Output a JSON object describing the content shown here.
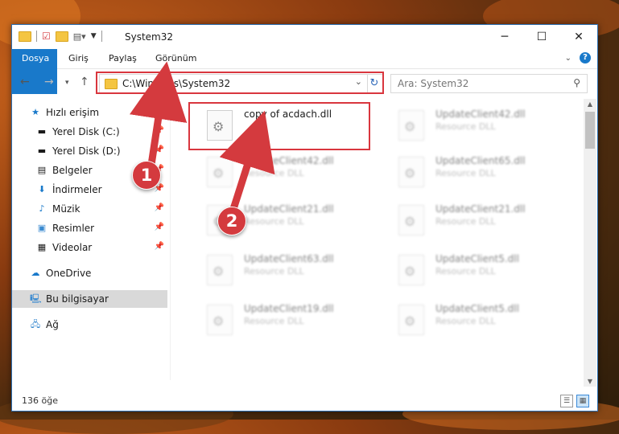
{
  "window": {
    "title": "System32"
  },
  "ribbon": {
    "tabs": [
      {
        "label": "Dosya"
      },
      {
        "label": "Giriş"
      },
      {
        "label": "Paylaş"
      },
      {
        "label": "Görünüm"
      }
    ]
  },
  "address": {
    "path": "C:\\Windows\\System32"
  },
  "search": {
    "placeholder": "Ara: System32"
  },
  "nav": {
    "quick_access": "Hızlı erişim",
    "items": [
      {
        "label": "Yerel Disk (C:)",
        "icon": "drive-icon"
      },
      {
        "label": "Yerel Disk (D:)",
        "icon": "drive-icon"
      },
      {
        "label": "Belgeler",
        "icon": "documents-icon"
      },
      {
        "label": "İndirmeler",
        "icon": "download-icon"
      },
      {
        "label": "Müzik",
        "icon": "music-icon"
      },
      {
        "label": "Resimler",
        "icon": "pictures-icon"
      },
      {
        "label": "Videolar",
        "icon": "videos-icon"
      }
    ],
    "onedrive": "OneDrive",
    "this_pc": "Bu bilgisayar",
    "network": "Ağ"
  },
  "files": {
    "highlighted": {
      "name": "copy of acdach.dll",
      "type": ""
    },
    "col1": [
      {
        "name": "UpdateClient42.dll",
        "type": "Resource DLL"
      },
      {
        "name": "UpdateClient21.dll",
        "type": "Resource DLL"
      },
      {
        "name": "UpdateClient63.dll",
        "type": "Resource DLL"
      },
      {
        "name": "UpdateClient19.dll",
        "type": "Resource DLL"
      }
    ],
    "col2": [
      {
        "name": "UpdateClient42.dll",
        "type": "Resource DLL"
      },
      {
        "name": "UpdateClient65.dll",
        "type": "Resource DLL"
      },
      {
        "name": "UpdateClient21.dll",
        "type": "Resource DLL"
      },
      {
        "name": "UpdateClient5.dll",
        "type": "Resource DLL"
      },
      {
        "name": "UpdateClient5.dll",
        "type": "Resource DLL"
      }
    ]
  },
  "status": {
    "count": "136 öğe"
  },
  "annotations": {
    "badge1": "1",
    "badge2": "2",
    "accent": "#d9363e"
  }
}
